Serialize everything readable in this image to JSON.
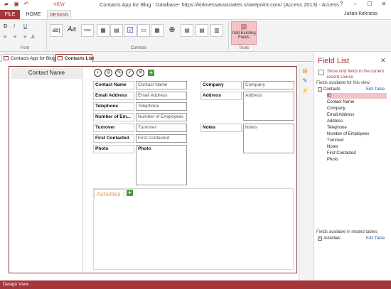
{
  "window": {
    "title": "Contacts App for Blog : Database- https://kirknessassociates.sharepoint.com/ (Access 2013) - Access",
    "user": "Julian Kirkness",
    "controls": [
      "?",
      "–",
      "☐",
      "✕"
    ]
  },
  "ribbon": {
    "contextual_label": "VIEW",
    "tabs": [
      "FILE",
      "HOME",
      "DESIGN"
    ],
    "groups": [
      "Font",
      "Controls",
      "Tools"
    ],
    "format_buttons": [
      "B",
      "I",
      "U",
      "A"
    ],
    "controls": [
      "ab|",
      "Aa",
      "xxxx",
      "▦",
      "▤",
      "☑",
      "▭",
      "▦",
      "⊕",
      "▤",
      "▤",
      "▥"
    ],
    "add_existing_fields": "Add Existing Fields"
  },
  "doc_tabs": [
    "Contacts App for Blog",
    "Contacts List"
  ],
  "form": {
    "header": "Contact Name",
    "action_buttons": [
      "+",
      "⊖",
      "✎",
      "✓",
      "✕"
    ],
    "left_labels": [
      "Contact Name",
      "Email Address",
      "Telephone",
      "Number of Em...",
      "Turnover",
      "First Contacted",
      "Photo"
    ],
    "left_fields": [
      "Contact Name",
      "Email Address",
      "Telephone",
      "Number of Employees",
      "Turnover",
      "First Contacted",
      "Photo"
    ],
    "right_labels": [
      "Company",
      "Address",
      "Notes"
    ],
    "right_fields": [
      "Company",
      "Address",
      "Notes"
    ],
    "activities_tab": "Activities"
  },
  "field_list": {
    "title": "Field List",
    "show_only": "Show only fields in the current record source",
    "available_label": "Fields available for this view:",
    "table": "Contacts",
    "edit_table": "Edit Table",
    "fields": [
      "ID",
      "Contact Name",
      "Company",
      "Email Address",
      "Address",
      "Telephone",
      "Number of Employees",
      "Turnover",
      "Notes",
      "First Contacted",
      "Photo"
    ],
    "related_label": "Fields available in related tables:",
    "related_table": "Activities",
    "related_edit": "Edit Table"
  },
  "status": {
    "text": "Design View"
  },
  "colors": {
    "accent": "#a4373a",
    "status_bar": "#a4373a",
    "highlight": "#f2c4c6"
  }
}
